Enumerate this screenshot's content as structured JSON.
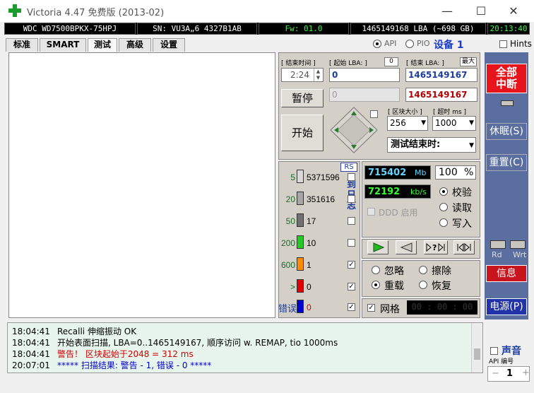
{
  "window": {
    "title": "Victoria 4.47  免费版 (2013-02)",
    "minimize": "—",
    "maximize": "☐",
    "close": "✕"
  },
  "infobar": {
    "model": "WDC WD7500BPKX-75HPJ",
    "serial": "SN: VU3A„6  4327B1AB",
    "firmware": "Fw: 01.0",
    "capacity": "1465149168 LBA (~698 GB)",
    "clock": "20:13:40"
  },
  "tabs": [
    "标准",
    "SMART",
    "测试",
    "高级",
    "设置"
  ],
  "mode": {
    "api": "API",
    "pio": "PIO",
    "device": "设备 1",
    "hints": "Hints"
  },
  "test": {
    "end_time_label": "[ 结束时间 ]",
    "end_time_value": "2:24",
    "start_lba_label": "[ 起始 LBA: ]",
    "start_lba_zero": "0",
    "start_lba_value": "0",
    "end_lba_label": "[ 结束 LBA: ]",
    "max_label": "最大",
    "end_lba_value": "1465149167",
    "current_lba_value": "0",
    "current_end_value": "1465149167",
    "pause_button": "暂停",
    "start_button": "开始",
    "block_size_label": "[ 区块大小 ]",
    "block_size_value": "256",
    "timeout_label": "[ 超时 ms ]",
    "timeout_value": "1000",
    "end_action": "测试结束时:"
  },
  "legend": {
    "rs_label": "RS",
    "vertical_label": "到日志",
    "error_label": "错误",
    "rows": [
      {
        "ms": "5",
        "count": "5371596",
        "color": "#d9d9d9",
        "checked": false
      },
      {
        "ms": "20",
        "count": "351616",
        "color": "#a6a6a6",
        "checked": false
      },
      {
        "ms": "50",
        "count": "17",
        "color": "#707070",
        "checked": false
      },
      {
        "ms": "200",
        "count": "10",
        "color": "#22cc22",
        "checked": false
      },
      {
        "ms": "600",
        "count": "1",
        "color": "#ff8c00",
        "checked": true
      },
      {
        "ms": ">",
        "count": "0",
        "color": "#e00000",
        "checked": true
      },
      {
        "ms": "",
        "count": "0",
        "color": "#0000cc",
        "checked": true
      }
    ]
  },
  "stats": {
    "speed_mb": "715402",
    "speed_mb_unit": "Mb",
    "percent": "100",
    "percent_unit": "%",
    "speed_kb": "72192",
    "speed_kb_unit": "kb/s",
    "ddd_label": "DDD 启用",
    "verify": "校验",
    "read": "读取",
    "write": "写入",
    "ignore": "忽略",
    "erase": "擦除",
    "remap": "重载",
    "restore": "恢复",
    "grid_label": "网格",
    "grid_time": "00 : 00 : 00"
  },
  "side": {
    "abort": "全部\n中断",
    "sleep": "休眠(S)",
    "reset": "重置(C)",
    "rd": "Rd",
    "wrt": "Wrt",
    "info": "信息",
    "power": "电源(P)",
    "sound": "声音",
    "api_num_label": "API 编号",
    "api_num_value": "1",
    "minus": "−",
    "plus": "+"
  },
  "log": [
    {
      "time": "18:04:41",
      "text": "Recalli 伸缩振动 OK",
      "color": "#000000"
    },
    {
      "time": "18:04:41",
      "text": "开始表面扫描, LBA=0..1465149167, 顺序访问 w. REMAP, tio 1000ms",
      "color": "#000000"
    },
    {
      "time": "18:04:41",
      "text": "警告！ 区块起始于2048 = 312 ms",
      "color": "#d00000"
    },
    {
      "time": "20:07:01",
      "text": "***** 扫描结果: 警告 - 1, 错误 - 0 *****",
      "color": "#0000cc"
    }
  ],
  "colors": {
    "abort_bg": "#e8141c",
    "info_bg": "#c8141c",
    "side_bg": "#5a6fa0",
    "log_bg": "#e8f5ec"
  }
}
